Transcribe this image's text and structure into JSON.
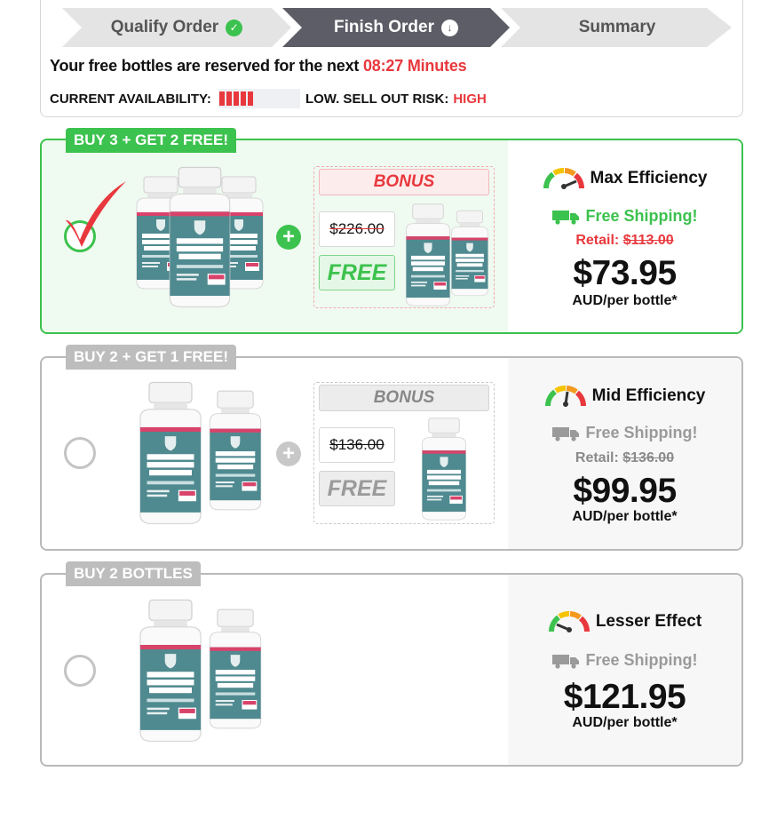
{
  "steps": [
    {
      "label": "Qualify Order",
      "icon": "check-circle-icon",
      "state": "done"
    },
    {
      "label": "Finish Order",
      "icon": "down-arrow-circle-icon",
      "state": "active"
    },
    {
      "label": "Summary",
      "state": "pending"
    }
  ],
  "timer": {
    "text": "Your free bottles are reserved for the next",
    "time": "08:27 Minutes"
  },
  "availability": {
    "label": "CURRENT AVAILABILITY:",
    "level": 0.4,
    "risk_label": "LOW. SELL OUT RISK:",
    "risk_value": "HIGH"
  },
  "colors": {
    "green": "#3cc24e",
    "red": "#e8383d",
    "teal": "#4f8a90",
    "grey": "#bdbdbd"
  },
  "packages": [
    {
      "tag": "BUY 3 + GET 2 FREE!",
      "selected": true,
      "bottles": 3,
      "bonus_label": "BONUS",
      "bonus_old_price": "$226.00",
      "bonus_free": "FREE",
      "bonus_bottles": 2,
      "efficiency": "Max Efficiency",
      "shipping": "Free Shipping!",
      "retail_label": "Retail:",
      "retail_price": "$113.00",
      "price": "$73.95",
      "per": "AUD/per bottle*"
    },
    {
      "tag": "BUY 2 + GET 1 FREE!",
      "selected": false,
      "bottles": 2,
      "bonus_label": "BONUS",
      "bonus_old_price": "$136.00",
      "bonus_free": "FREE",
      "bonus_bottles": 1,
      "efficiency": "Mid Efficiency",
      "shipping": "Free Shipping!",
      "retail_label": "Retail:",
      "retail_price": "$136.00",
      "price": "$99.95",
      "per": "AUD/per bottle*"
    },
    {
      "tag": "BUY 2 BOTTLES",
      "selected": false,
      "bottles": 2,
      "efficiency": "Lesser Effect",
      "shipping": "Free Shipping!",
      "price": "$121.95",
      "per": "AUD/per bottle*"
    }
  ],
  "product": {
    "line1": "SENTINEL",
    "line2": "GLYCOGEN",
    "line3": "CONTROL",
    "badge": "800MG",
    "top": "DIETARY SUPPLEMENT",
    "sub": "100% PURE INGREDIENTS"
  }
}
